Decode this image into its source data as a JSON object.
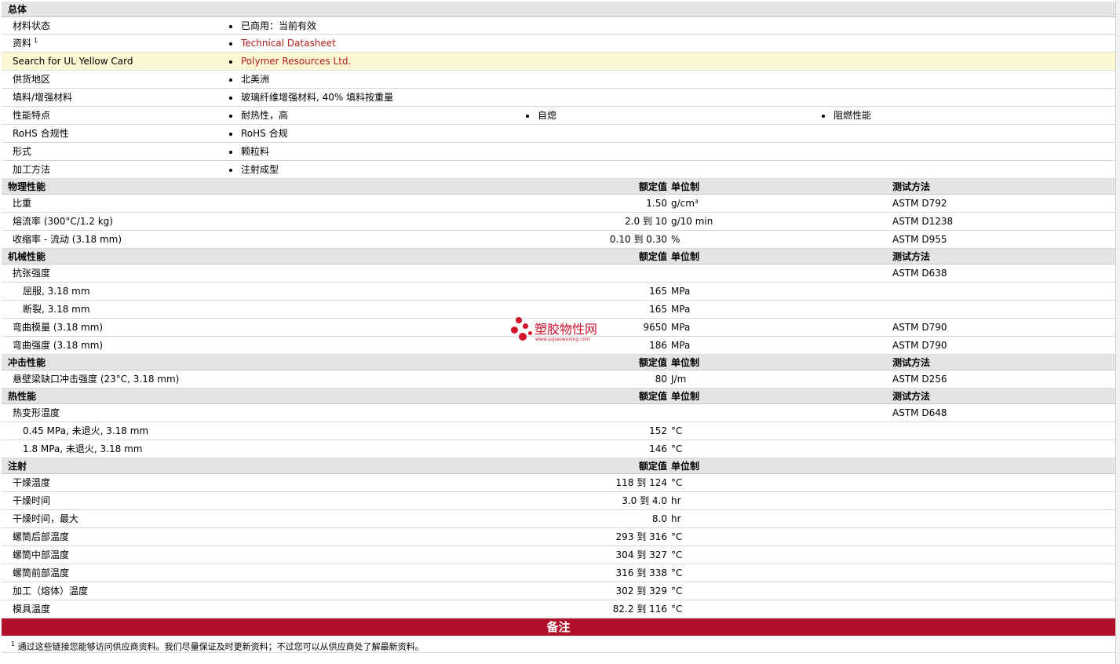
{
  "sections": {
    "general": {
      "title": "总体",
      "rows": [
        {
          "label": "材料状态",
          "value": "已商用：当前有效"
        },
        {
          "label": "资料",
          "sup": "1",
          "value": "Technical Datasheet"
        },
        {
          "label": "Search for UL Yellow Card",
          "value": "Polymer Resources Ltd."
        },
        {
          "label": "供货地区",
          "value": "北美洲"
        },
        {
          "label": "填料/增强材料",
          "value": "玻璃纤维增强材料, 40% 填料按重量"
        },
        {
          "label": "性能特点",
          "values": [
            "耐热性，高",
            "自熄",
            "阻燃性能"
          ]
        },
        {
          "label": "RoHS 合规性",
          "value": "RoHS 合规"
        },
        {
          "label": "形式",
          "value": "颗粒料"
        },
        {
          "label": "加工方法",
          "value": "注射成型"
        }
      ]
    },
    "headers": {
      "nominal": "额定值",
      "unit": "单位制",
      "test": "测试方法"
    },
    "physical": {
      "title": "物理性能",
      "rows": [
        {
          "label": "比重",
          "value": "1.50",
          "unit": "g/cm³",
          "test": "ASTM D792"
        },
        {
          "label": "熔流率 (300°C/1.2 kg)",
          "value": "2.0 到  10",
          "unit": "g/10 min",
          "test": "ASTM D1238"
        },
        {
          "label": "收缩率  - 流动 (3.18 mm)",
          "value": "0.10 到  0.30",
          "unit": "%",
          "test": "ASTM D955"
        }
      ]
    },
    "mechanical": {
      "title": "机械性能",
      "rows": [
        {
          "label": "抗张强度",
          "value": "",
          "unit": "",
          "test": "ASTM D638"
        },
        {
          "label": "屈服, 3.18 mm",
          "sub": true,
          "value": "165",
          "unit": "MPa",
          "test": ""
        },
        {
          "label": "断裂, 3.18 mm",
          "sub": true,
          "value": "165",
          "unit": "MPa",
          "test": ""
        },
        {
          "label": "弯曲模量 (3.18 mm)",
          "value": "9650",
          "unit": "MPa",
          "test": "ASTM D790"
        },
        {
          "label": "弯曲强度 (3.18 mm)",
          "value": "186",
          "unit": "MPa",
          "test": "ASTM D790"
        }
      ]
    },
    "impact": {
      "title": "冲击性能",
      "rows": [
        {
          "label": "悬壁梁缺口冲击强度 (23°C, 3.18 mm)",
          "value": "80",
          "unit": "J/m",
          "test": "ASTM D256"
        }
      ]
    },
    "thermal": {
      "title": "热性能",
      "rows": [
        {
          "label": "热变形温度",
          "value": "",
          "unit": "",
          "test": "ASTM D648"
        },
        {
          "label": "0.45 MPa, 未退火, 3.18 mm",
          "sub": true,
          "value": "152",
          "unit": "°C",
          "test": ""
        },
        {
          "label": "1.8 MPa, 未退火, 3.18 mm",
          "sub": true,
          "value": "146",
          "unit": "°C",
          "test": ""
        }
      ]
    },
    "injection": {
      "title": "注射",
      "rows": [
        {
          "label": "干燥温度",
          "value": "118 到  124",
          "unit": "°C"
        },
        {
          "label": "干燥时间",
          "value": "3.0 到  4.0",
          "unit": "hr"
        },
        {
          "label": "干燥时间，最大",
          "value": "8.0",
          "unit": "hr"
        },
        {
          "label": "螺筒后部温度",
          "value": "293 到  316",
          "unit": "°C"
        },
        {
          "label": "螺筒中部温度",
          "value": "304 到  327",
          "unit": "°C"
        },
        {
          "label": "螺筒前部温度",
          "value": "316 到  338",
          "unit": "°C"
        },
        {
          "label": "加工（熔体）温度",
          "value": "302 到  329",
          "unit": "°C"
        },
        {
          "label": "模具温度",
          "value": "82.2 到  116",
          "unit": "°C"
        }
      ]
    }
  },
  "notes": {
    "title": "备注",
    "footnote_mark": "1",
    "footnote": "通过这些链接您能够访问供应商资料。我们尽量保证及时更新资料；不过您可以从供应商处了解最新资料。"
  },
  "watermark": {
    "text": "塑胶物性网",
    "url": "www.sujiaowuxing.com"
  },
  "colors": {
    "section_bg": "#e4e4e4",
    "highlight_bg": "#fdf7d3",
    "link": "#b31b1b",
    "notes_bar": "#b0102a"
  }
}
